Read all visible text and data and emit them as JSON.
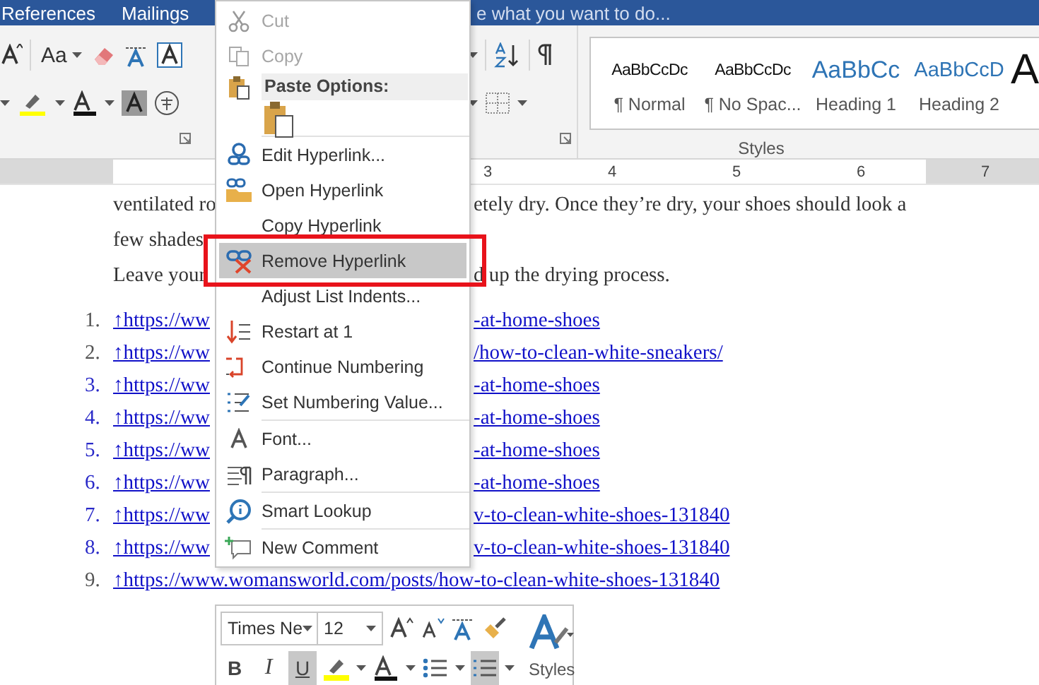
{
  "tabs": [
    {
      "label": "References",
      "selected": false
    },
    {
      "label": "Mailings",
      "selected": false
    }
  ],
  "tell_me": {
    "placeholder": "e what you want to do..."
  },
  "ribbon": {
    "change_case": {
      "label": "Aa"
    },
    "styles": {
      "items": [
        {
          "sample": "AaBbCcDc",
          "name": "¶ Normal",
          "kind": "body"
        },
        {
          "sample": "AaBbCcDc",
          "name": "¶ No Spac...",
          "kind": "body"
        },
        {
          "sample": "AaBbCc",
          "name": "Heading 1",
          "kind": "heading1"
        },
        {
          "sample": "AaBbCcD",
          "name": "Heading 2",
          "kind": "heading2"
        },
        {
          "sample": "A",
          "kind": "title"
        }
      ],
      "label": "Styles"
    }
  },
  "ruler": {
    "numbers": [
      "3",
      "4",
      "5",
      "6",
      "7"
    ]
  },
  "document": {
    "paragraph_lines": [
      {
        "left": "ventilated ro",
        "right": "etely dry. Once they’re dry, your shoes should look a"
      },
      {
        "left": "few shades"
      },
      {
        "left": "Leave your",
        "right": "d up the drying process."
      }
    ],
    "list_items": [
      {
        "number": "1.",
        "left": "↑https://ww",
        "right": "-at-home-shoes",
        "highlighted": false
      },
      {
        "number": "2.",
        "left": "↑https://ww",
        "right": "/how-to-clean-white-sneakers/",
        "highlighted": false
      },
      {
        "number": "3.",
        "left": "↑https://ww",
        "right": "-at-home-shoes",
        "highlighted": true
      },
      {
        "number": "4.",
        "left": "↑https://ww",
        "right": "-at-home-shoes",
        "highlighted": true
      },
      {
        "number": "5.",
        "left": "↑https://ww",
        "right": "-at-home-shoes",
        "highlighted": true
      },
      {
        "number": "6.",
        "left": "↑https://ww",
        "right": "-at-home-shoes",
        "highlighted": true
      },
      {
        "number": "7.",
        "left": "↑https://ww",
        "right": "v-to-clean-white-shoes-131840",
        "highlighted": true
      },
      {
        "number": "8.",
        "left": "↑https://ww",
        "right": "v-to-clean-white-shoes-131840",
        "highlighted": true
      },
      {
        "number": "9.",
        "left": "↑https://www.womansworld.com/posts/how-to-clean-white-shoes-131840",
        "highlighted": false
      }
    ]
  },
  "context_menu": {
    "items": [
      {
        "kind": "command",
        "label": "Cut",
        "disabled": true,
        "selected": false,
        "outlined": false
      },
      {
        "kind": "command",
        "label": "Copy",
        "disabled": true,
        "selected": false,
        "outlined": false
      },
      {
        "kind": "header",
        "label": "Paste Options:"
      },
      {
        "kind": "paste"
      },
      {
        "kind": "separator"
      },
      {
        "kind": "command",
        "label": "Edit Hyperlink...",
        "disabled": false,
        "selected": false,
        "outlined": false
      },
      {
        "kind": "command",
        "label": "Open Hyperlink",
        "disabled": false,
        "selected": false,
        "outlined": false
      },
      {
        "kind": "command",
        "label": "Copy Hyperlink",
        "disabled": false,
        "selected": false,
        "outlined": false
      },
      {
        "kind": "command",
        "label": "Remove Hyperlink",
        "disabled": false,
        "selected": true,
        "outlined": true
      },
      {
        "kind": "command",
        "label": "Adjust List Indents...",
        "disabled": false,
        "selected": false,
        "outlined": false
      },
      {
        "kind": "command",
        "label": "Restart at 1",
        "disabled": false,
        "selected": false,
        "outlined": false
      },
      {
        "kind": "command",
        "label": "Continue Numbering",
        "disabled": false,
        "selected": false,
        "outlined": false
      },
      {
        "kind": "command",
        "label": "Set Numbering Value...",
        "disabled": false,
        "selected": false,
        "outlined": false
      },
      {
        "kind": "separator"
      },
      {
        "kind": "command",
        "label": "Font...",
        "disabled": false,
        "selected": false,
        "outlined": false
      },
      {
        "kind": "command",
        "label": "Paragraph...",
        "disabled": false,
        "selected": false,
        "outlined": false
      },
      {
        "kind": "separator"
      },
      {
        "kind": "command",
        "label": "Smart Lookup",
        "disabled": false,
        "selected": false,
        "outlined": false
      },
      {
        "kind": "separator"
      },
      {
        "kind": "command",
        "label": "New Comment",
        "disabled": false,
        "selected": false,
        "outlined": false
      }
    ]
  },
  "mini_toolbar": {
    "font": {
      "value": "Times Ne"
    },
    "size": {
      "value": "12"
    },
    "styles_label": "Styles",
    "buttons": [
      {
        "kind": "bold",
        "label": "B",
        "pressed": false
      },
      {
        "kind": "italic",
        "label": "I",
        "pressed": false
      },
      {
        "kind": "underline",
        "label": "U",
        "pressed": true
      },
      {
        "kind": "highlight",
        "pressed": false
      },
      {
        "kind": "font_color",
        "pressed": false
      },
      {
        "kind": "bullets",
        "pressed": false
      },
      {
        "kind": "numbering",
        "pressed": true
      }
    ]
  }
}
